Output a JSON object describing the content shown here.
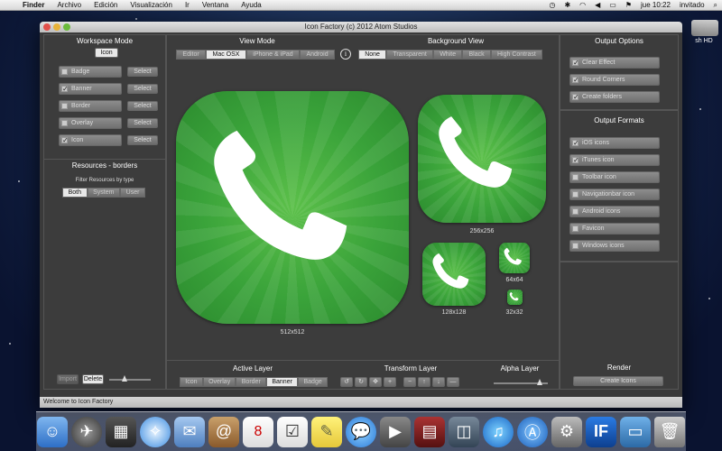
{
  "menubar": {
    "app": "Finder",
    "items": [
      "Archivo",
      "Edición",
      "Visualización",
      "Ir",
      "Ventana",
      "Ayuda"
    ],
    "clock": "jue 10:22",
    "user": "invitado"
  },
  "desktop": {
    "disk_label": "sh HD"
  },
  "window": {
    "title": "Icon Factory (c) 2012 Atom Studios"
  },
  "workspace": {
    "title": "Workspace Mode",
    "mode_button": "Icon",
    "layers": [
      {
        "label": "Badge",
        "checked": false,
        "select": "Select"
      },
      {
        "label": "Banner",
        "checked": true,
        "select": "Select"
      },
      {
        "label": "Border",
        "checked": false,
        "select": "Select"
      },
      {
        "label": "Overlay",
        "checked": false,
        "select": "Select"
      },
      {
        "label": "Icon",
        "checked": true,
        "select": "Select"
      }
    ]
  },
  "resources": {
    "title": "Resources - borders",
    "filter_label": "Filter Resources by type",
    "filters": [
      "Both",
      "System",
      "User"
    ],
    "selected_filter": "Both",
    "import_label": "Import",
    "delete_label": "Delete"
  },
  "view_mode": {
    "title": "View Mode",
    "options": [
      "Editor",
      "Mac OSX",
      "iPhone & iPad",
      "Android"
    ],
    "selected": "Mac OSX"
  },
  "background_view": {
    "title": "Background View",
    "options": [
      "None",
      "Transparent",
      "White",
      "Black",
      "High Contrast"
    ],
    "selected": "None"
  },
  "previews": [
    {
      "size": "512x512"
    },
    {
      "size": "256x256"
    },
    {
      "size": "128x128"
    },
    {
      "size": "64x64"
    },
    {
      "size": "32x32"
    }
  ],
  "output_options": {
    "title": "Output Options",
    "items": [
      {
        "label": "Clear Effect",
        "checked": true
      },
      {
        "label": "Round Corners",
        "checked": true
      },
      {
        "label": "Create folders",
        "checked": true
      }
    ]
  },
  "output_formats": {
    "title": "Output Formats",
    "items": [
      {
        "label": "iOS icons",
        "checked": true
      },
      {
        "label": "iTunes icon",
        "checked": true
      },
      {
        "label": "Toolbar icon",
        "checked": false
      },
      {
        "label": "Navigationbar icon",
        "checked": false
      },
      {
        "label": "Android icons",
        "checked": false
      },
      {
        "label": "Favicon",
        "checked": false
      },
      {
        "label": "Windows icons",
        "checked": false
      }
    ]
  },
  "active_layer": {
    "title": "Active Layer",
    "options": [
      "Icon",
      "Overlay",
      "Border",
      "Banner",
      "Badge"
    ],
    "selected": "Banner"
  },
  "transform_layer": {
    "title": "Transform Layer"
  },
  "alpha_layer": {
    "title": "Alpha Layer",
    "value": 0.85
  },
  "render": {
    "title": "Render",
    "button": "Create Icons"
  },
  "status": "Welcome to Icon Factory",
  "colors": {
    "icon_green": "#3aa33a",
    "panel": "#3c3c3c",
    "selected_button": "#e8e8e8"
  }
}
